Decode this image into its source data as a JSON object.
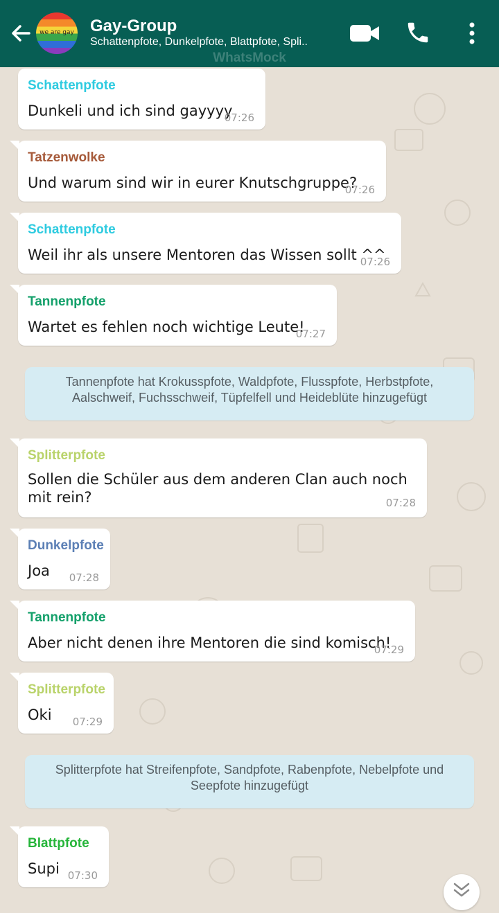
{
  "header": {
    "title": "Gay-Group",
    "subtitle": "Schattenpfote, Dunkelpfote, Blattpfote, Spli..",
    "avatar_text": "we are gay",
    "watermark": "WhatsMock"
  },
  "icons": {
    "back": "arrow-left-icon",
    "video": "video-call-icon",
    "phone": "phone-call-icon",
    "menu": "more-vertical-icon",
    "scroll": "chevron-double-down-icon"
  },
  "colors": {
    "header": "#075e54",
    "chat_bg": "#e7e0d6",
    "system_bubble": "#d6ecf3"
  },
  "messages": [
    {
      "sender": "Schattenpfote",
      "color": "#2ecbe0",
      "text": "Dunkeli und ich sind gayyyy",
      "time": "07:26"
    },
    {
      "sender": "Tatzenwolke",
      "color": "#a65a3a",
      "text": "Und warum  sind wir in eurer Knutschgruppe?",
      "time": "07:26"
    },
    {
      "sender": "Schattenpfote",
      "color": "#2ecbe0",
      "text": "Weil ihr als unsere Mentoren das Wissen sollt ^^",
      "time": "07:26"
    },
    {
      "sender": "Tannenpfote",
      "color": "#13a06a",
      "text": "Wartet es fehlen noch wichtige Leute!",
      "time": "07:27"
    },
    {
      "system": "Tannenpfote hat Krokusspfote, Waldpfote, Flusspfote, Herbstpfote, Aalschweif, Fuchsschweif, Tüpfelfell und Heideblüte hinzugefügt"
    },
    {
      "sender": "Splitterpfote",
      "color": "#b9d36a",
      "text": "Sollen die Schüler aus dem anderen Clan auch noch mit rein?",
      "time": "07:28"
    },
    {
      "sender": "Dunkelpfote",
      "color": "#5b7fb5",
      "text": "Joa",
      "time": "07:28"
    },
    {
      "sender": "Tannenpfote",
      "color": "#13a06a",
      "text": "Aber nicht denen ihre Mentoren die sind komisch!",
      "time": "07:29"
    },
    {
      "sender": "Splitterpfote",
      "color": "#b9d36a",
      "text": "Oki",
      "time": "07:29"
    },
    {
      "system": "Splitterpfote hat Streifenpfote, Sandpfote, Rabenpfote, Nebelpfote und Seepfote hinzugefügt"
    },
    {
      "sender": "Blattpfote",
      "color": "#26b53a",
      "text": "Supi",
      "time": "07:30"
    }
  ]
}
